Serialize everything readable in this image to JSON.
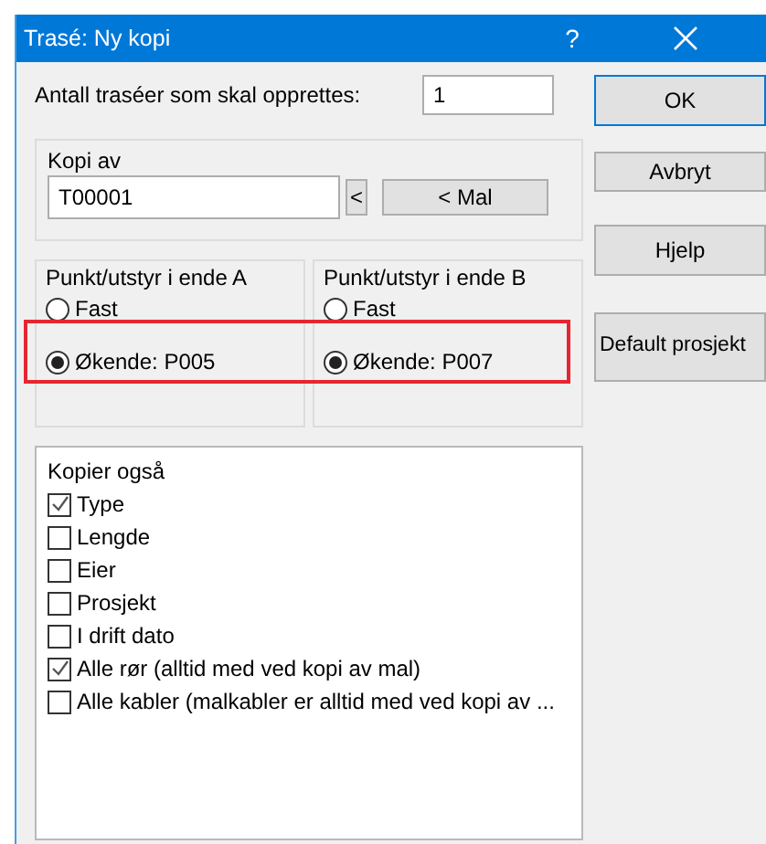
{
  "window": {
    "title": "Trasé: Ny kopi",
    "help_button": "?"
  },
  "count": {
    "label": "Antall traséer som skal opprettes:",
    "value": "1"
  },
  "copy_of": {
    "title": "Kopi av",
    "value": "T00001",
    "pick_button": "<",
    "template_button": "< Mal"
  },
  "ends": [
    {
      "title": "Punkt/utstyr i ende A",
      "options": [
        {
          "label": "Fast",
          "selected": false
        },
        {
          "label": "Økende: P005",
          "selected": true
        }
      ]
    },
    {
      "title": "Punkt/utstyr i ende B",
      "options": [
        {
          "label": "Fast",
          "selected": false
        },
        {
          "label": "Økende: P007",
          "selected": true
        }
      ]
    }
  ],
  "highlight": true,
  "also_copy": {
    "title": "Kopier også",
    "items": [
      {
        "label": "Type",
        "checked": true
      },
      {
        "label": "Lengde",
        "checked": false
      },
      {
        "label": "Eier",
        "checked": false
      },
      {
        "label": "Prosjekt",
        "checked": false
      },
      {
        "label": "I drift dato",
        "checked": false
      },
      {
        "label": "Alle rør (alltid med ved kopi av mal)",
        "checked": true
      },
      {
        "label": "Alle kabler (malkabler er alltid med ved kopi av ...",
        "checked": false
      }
    ]
  },
  "buttons": [
    "OK",
    "Avbryt",
    "Hjelp",
    "Default prosjekt"
  ]
}
